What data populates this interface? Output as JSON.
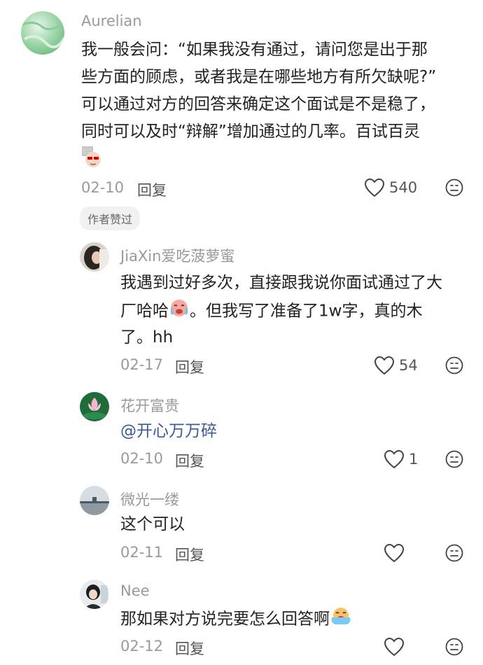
{
  "colors": {
    "muted": "#9a9a9a",
    "mention": "#3b5b94",
    "text": "#222222"
  },
  "comments": [
    {
      "user": "Aurelian",
      "lines": [
        "我一般会问：“如果我没有通过，请问您是出于那",
        "些方面的顾虑，或者我是在哪些地方有所欠缺呢?”",
        "可以通过对方的回答来确定这个面试是不是稳了，",
        "同时可以及时“辩解”增加通过的几率。百试百灵"
      ],
      "date": "02-10",
      "reply": "回复",
      "likes": "540",
      "badge": "作者赞过"
    },
    {
      "user": "JiaXin爱吃菠萝蜜",
      "lines": [
        "我遇到过好多次，直接跟我说你面试通过了大",
        "厂哈哈",
        "。但我写了准备了1w字，真的木",
        "了。hh"
      ],
      "date": "02-17",
      "reply": "回复",
      "likes": "54"
    },
    {
      "user": "花开富贵",
      "mention": "@开心万万碎",
      "date": "02-10",
      "reply": "回复",
      "likes": "1"
    },
    {
      "user": "微光一缕",
      "lines": [
        "这个可以"
      ],
      "date": "02-11",
      "reply": "回复",
      "likes": ""
    },
    {
      "user": "Nee",
      "lines": [
        "那如果对方说完要怎么回答啊"
      ],
      "date": "02-12",
      "reply": "回复",
      "likes": ""
    }
  ],
  "icons": {
    "like": "heart-outline-icon",
    "dislike": "meh-face-icon",
    "emoji_sticker": "mask-face-sticker",
    "emoji_cry": "crying-laugh-emoji"
  }
}
